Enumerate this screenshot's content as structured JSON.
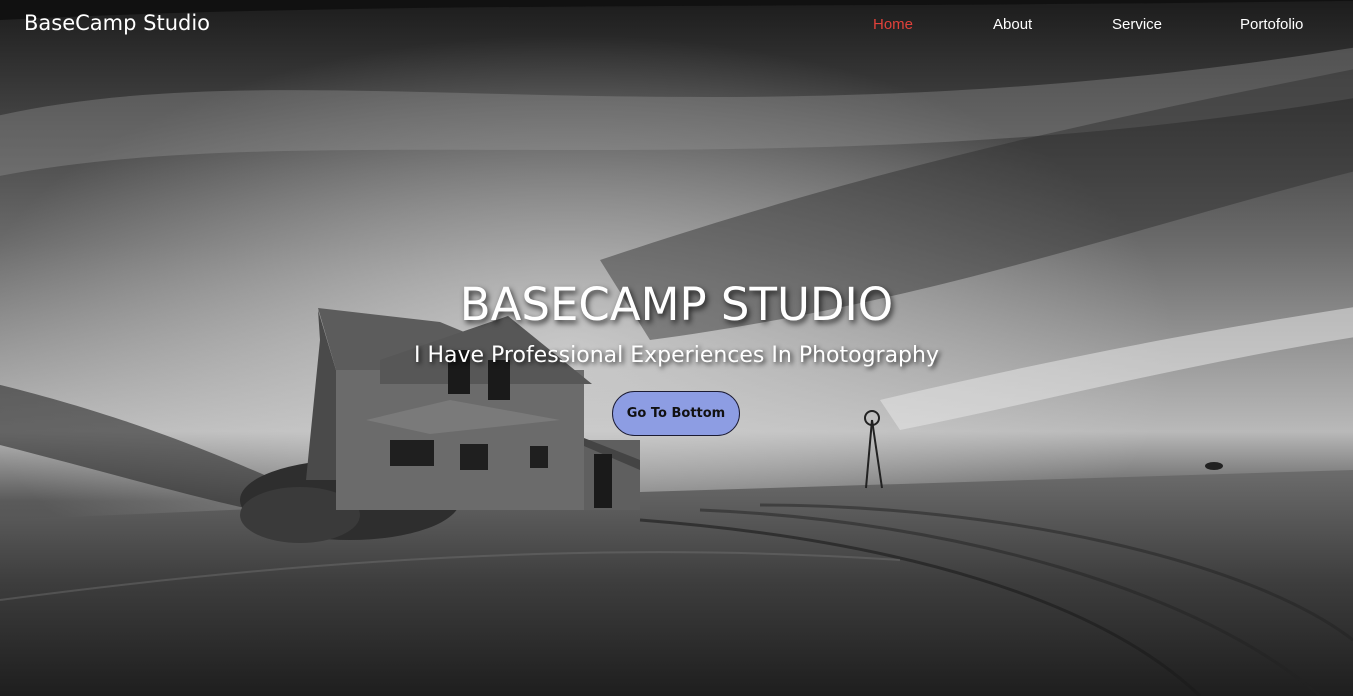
{
  "brand": {
    "name": "BaseCamp Studio"
  },
  "nav": {
    "items": [
      {
        "label": "Home",
        "active": true
      },
      {
        "label": "About",
        "active": false
      },
      {
        "label": "Service",
        "active": false
      },
      {
        "label": "Portofolio",
        "active": false
      }
    ],
    "active_color": "#e0413a"
  },
  "hero": {
    "title": "BASECAMP STUDIO",
    "subtitle": "I Have Professional Experiences In Photography",
    "cta_label": "Go To Bottom",
    "cta_color": "#8d9de3"
  }
}
